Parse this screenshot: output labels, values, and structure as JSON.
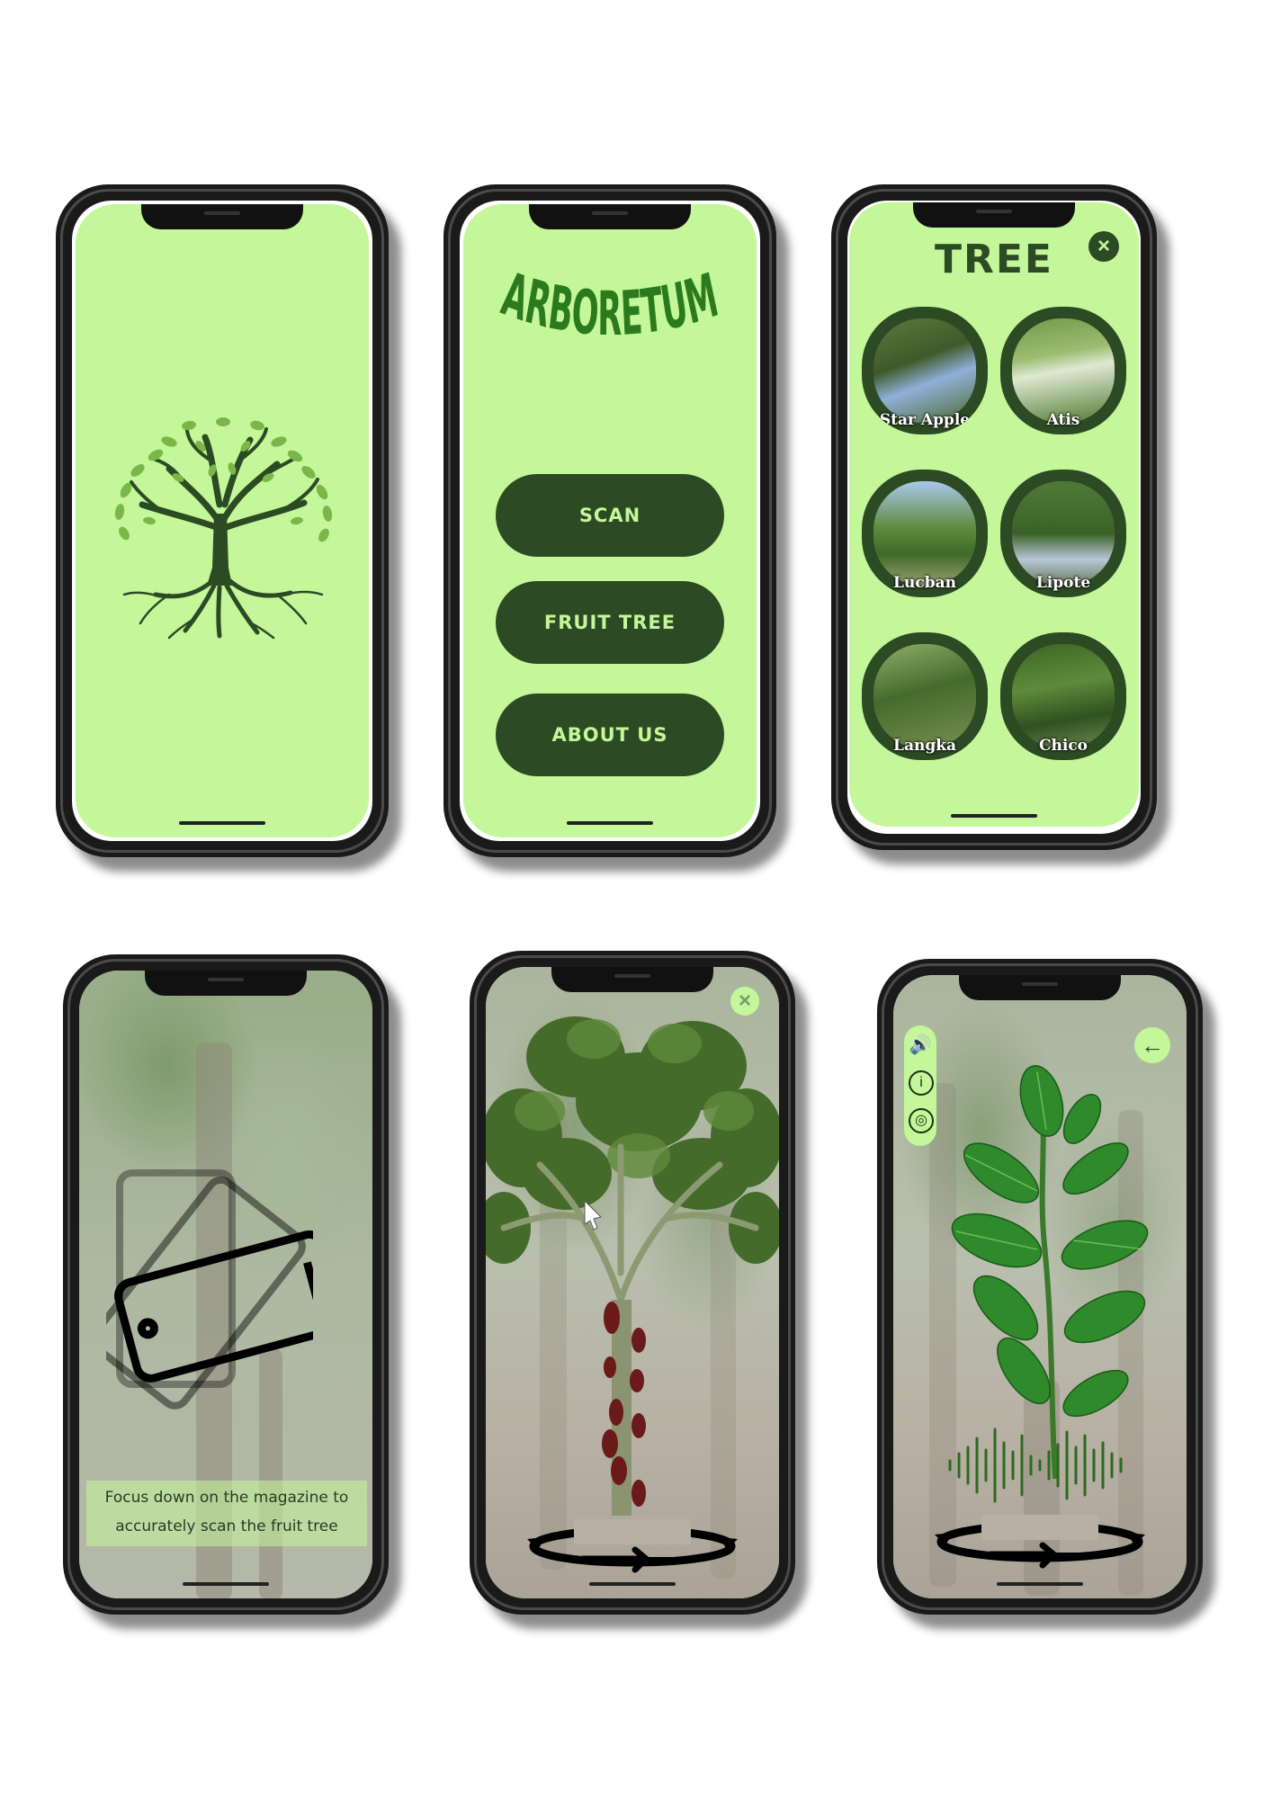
{
  "colors": {
    "screen_bg": "#c4f79a",
    "dark_green": "#2c4a23",
    "button_text": "#c4f79a"
  },
  "splash": {
    "logo_icon": "tree-of-life-logo"
  },
  "menu": {
    "title": "ARBORETUM",
    "buttons": [
      {
        "label": "SCAN"
      },
      {
        "label": "FRUIT TREE"
      },
      {
        "label": "ABOUT US"
      }
    ]
  },
  "tree_list": {
    "title": "TREE",
    "close_icon": "close-icon",
    "trees": [
      {
        "label": "Star Apple"
      },
      {
        "label": "Atis"
      },
      {
        "label": "Lucban"
      },
      {
        "label": "Lipote"
      },
      {
        "label": "Langka"
      },
      {
        "label": "Chico"
      }
    ]
  },
  "scan": {
    "caption_line1": "Focus down on the magazine  to",
    "caption_line2": "accurately scan the fruit tree"
  },
  "ar_tree": {
    "close_icon": "close-icon",
    "rotate_icon": "rotate-arrow-icon"
  },
  "ar_plant": {
    "back_icon": "back-arrow-icon",
    "menu_icons": [
      "speaker-icon",
      "info-icon",
      "globe-icon"
    ],
    "audio_icon": "sound-wave-icon",
    "rotate_icon": "rotate-arrow-icon"
  }
}
